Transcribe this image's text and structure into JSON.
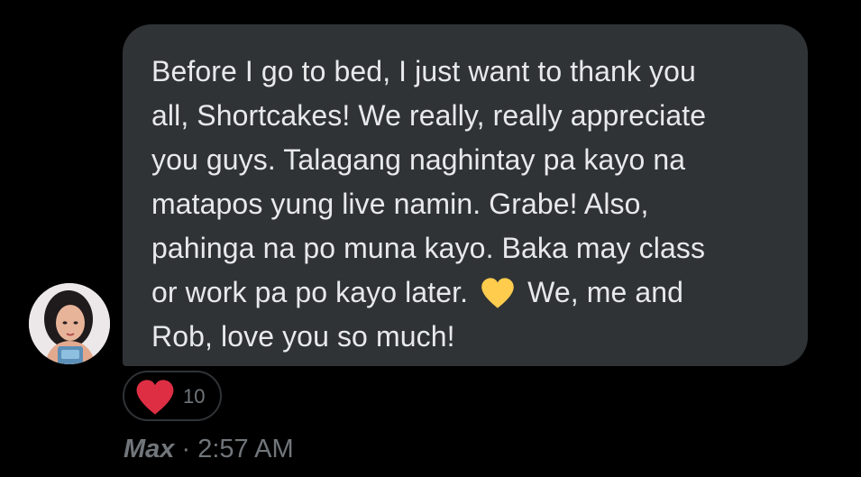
{
  "message": {
    "text": "Before I go to bed, I just want to thank you\nall, Shortcakes! We really, really appreciate\nyou guys. Talagang naghintay pa kayo na\nmatapos yung live namin. Grabe! Also,\npahinga na po muna kayo. Baka may class\nor work pa po kayo later.",
    "text_after_emoji": "We, me and\nRob, love you so much!",
    "emoji": "yellow-heart-icon",
    "sender": "Max",
    "separator": "·",
    "time": "2:57 AM"
  },
  "reaction": {
    "icon": "red-heart-icon",
    "count": "10"
  },
  "colors": {
    "background": "#000000",
    "bubble": "#2f3336",
    "text": "#e7e9ea",
    "muted": "#71767b",
    "heart_red": "#f91880",
    "heart_yellow": "#ffcc4d"
  }
}
